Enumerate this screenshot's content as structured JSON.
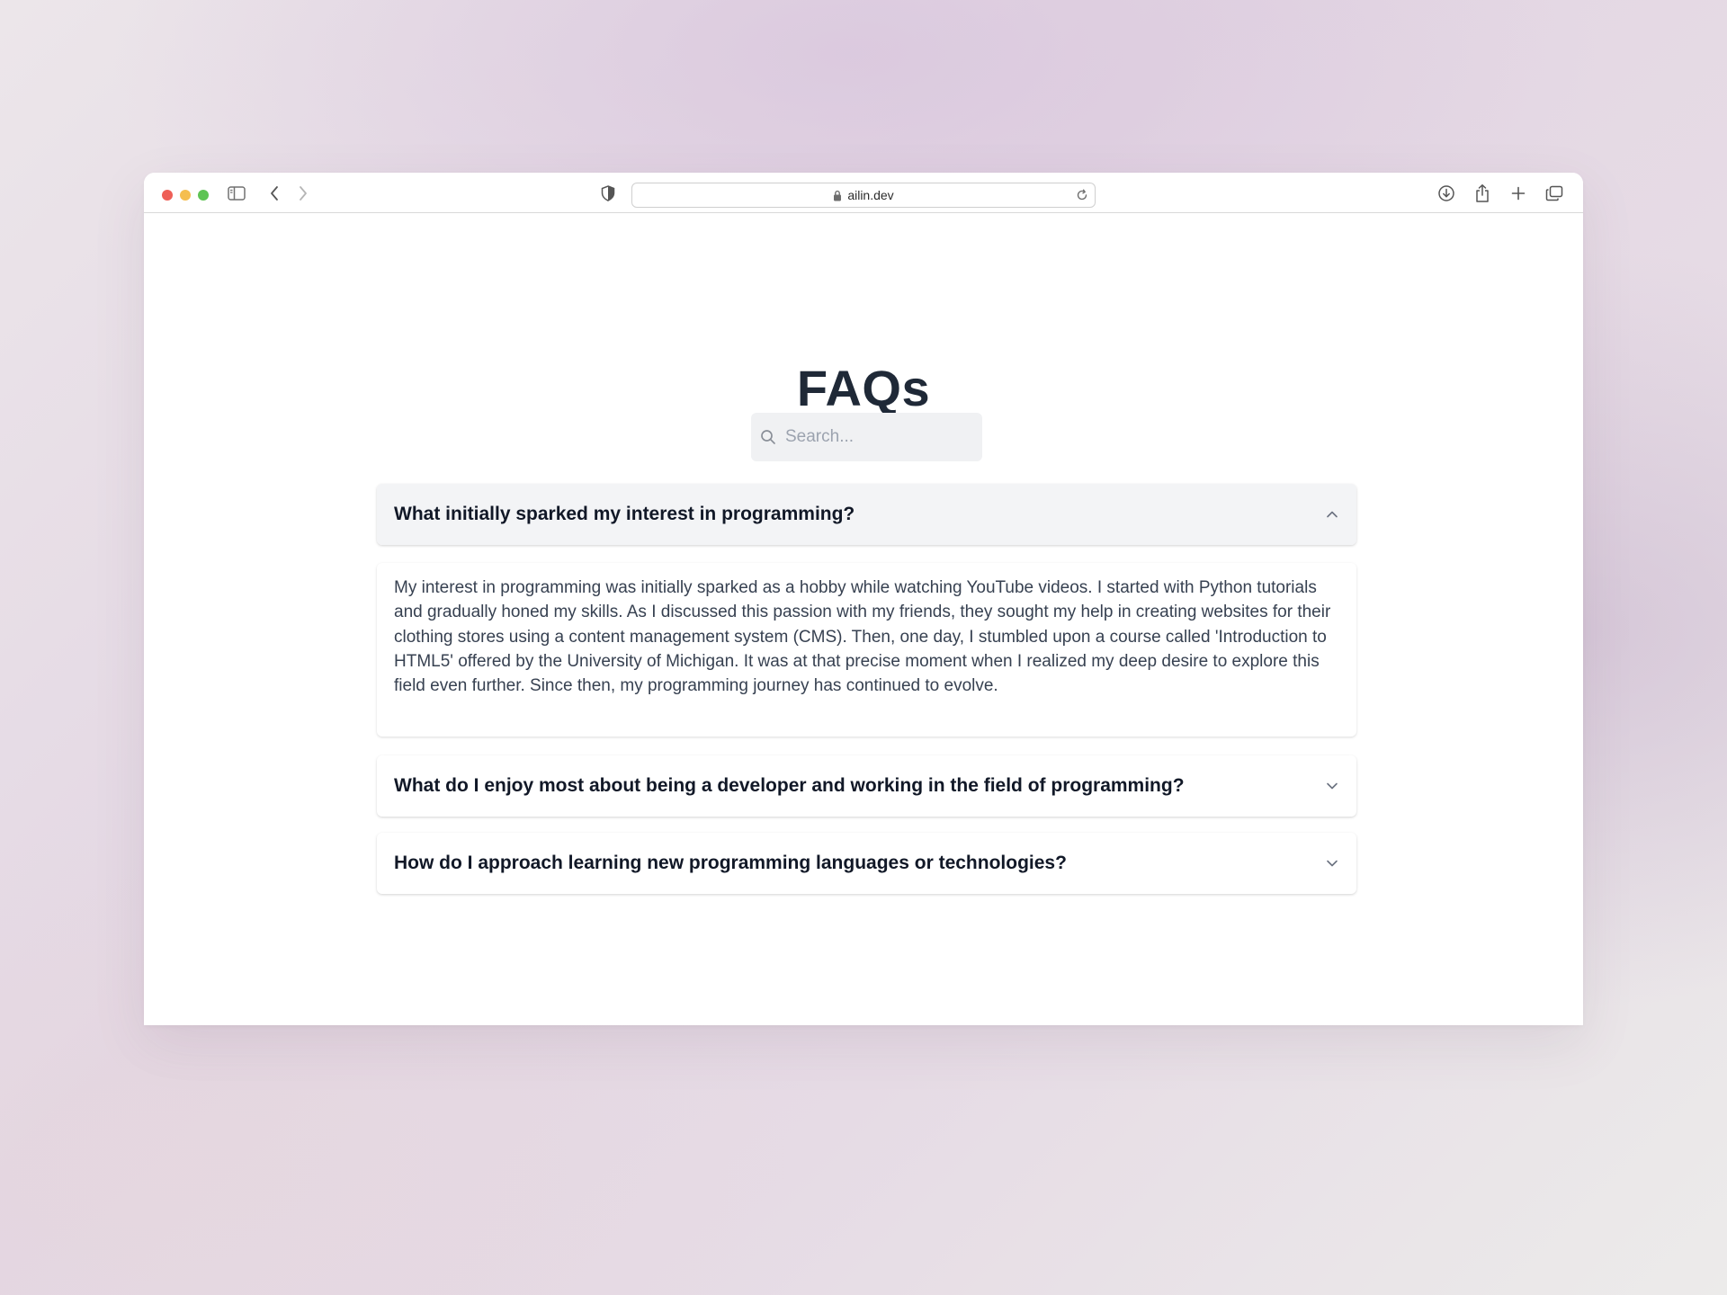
{
  "browser": {
    "url": "ailin.dev"
  },
  "page": {
    "title": "FAQs",
    "search": {
      "placeholder": "Search..."
    }
  },
  "faqs": [
    {
      "question": "What initially sparked my interest in programming?",
      "expanded": true,
      "answer": "My interest in programming was initially sparked as a hobby while watching YouTube videos. I started with Python tutorials and gradually honed my skills. As I discussed this passion with my friends, they sought my help in creating websites for their clothing stores using a content management system (CMS). Then, one day, I stumbled upon a course called 'Introduction to HTML5' offered by the University of Michigan. It was at that precise moment when I realized my deep desire to explore this field even further. Since then, my programming journey has continued to evolve."
    },
    {
      "question": "What do I enjoy most about being a developer and working in the field of programming?",
      "expanded": false
    },
    {
      "question": "How do I approach learning new programming languages or technologies?",
      "expanded": false
    }
  ],
  "icons": {
    "sidebar": "sidebar-icon",
    "back": "chevron-left-icon",
    "forward": "chevron-right-icon",
    "privacy": "shield-icon",
    "lock": "lock-icon",
    "reload": "reload-icon",
    "download": "download-icon",
    "share": "share-icon",
    "new_tab": "plus-icon",
    "tabs": "tabs-overview-icon",
    "search": "search-icon",
    "collapse": "chevron-up-icon",
    "expand": "chevron-down-icon"
  }
}
